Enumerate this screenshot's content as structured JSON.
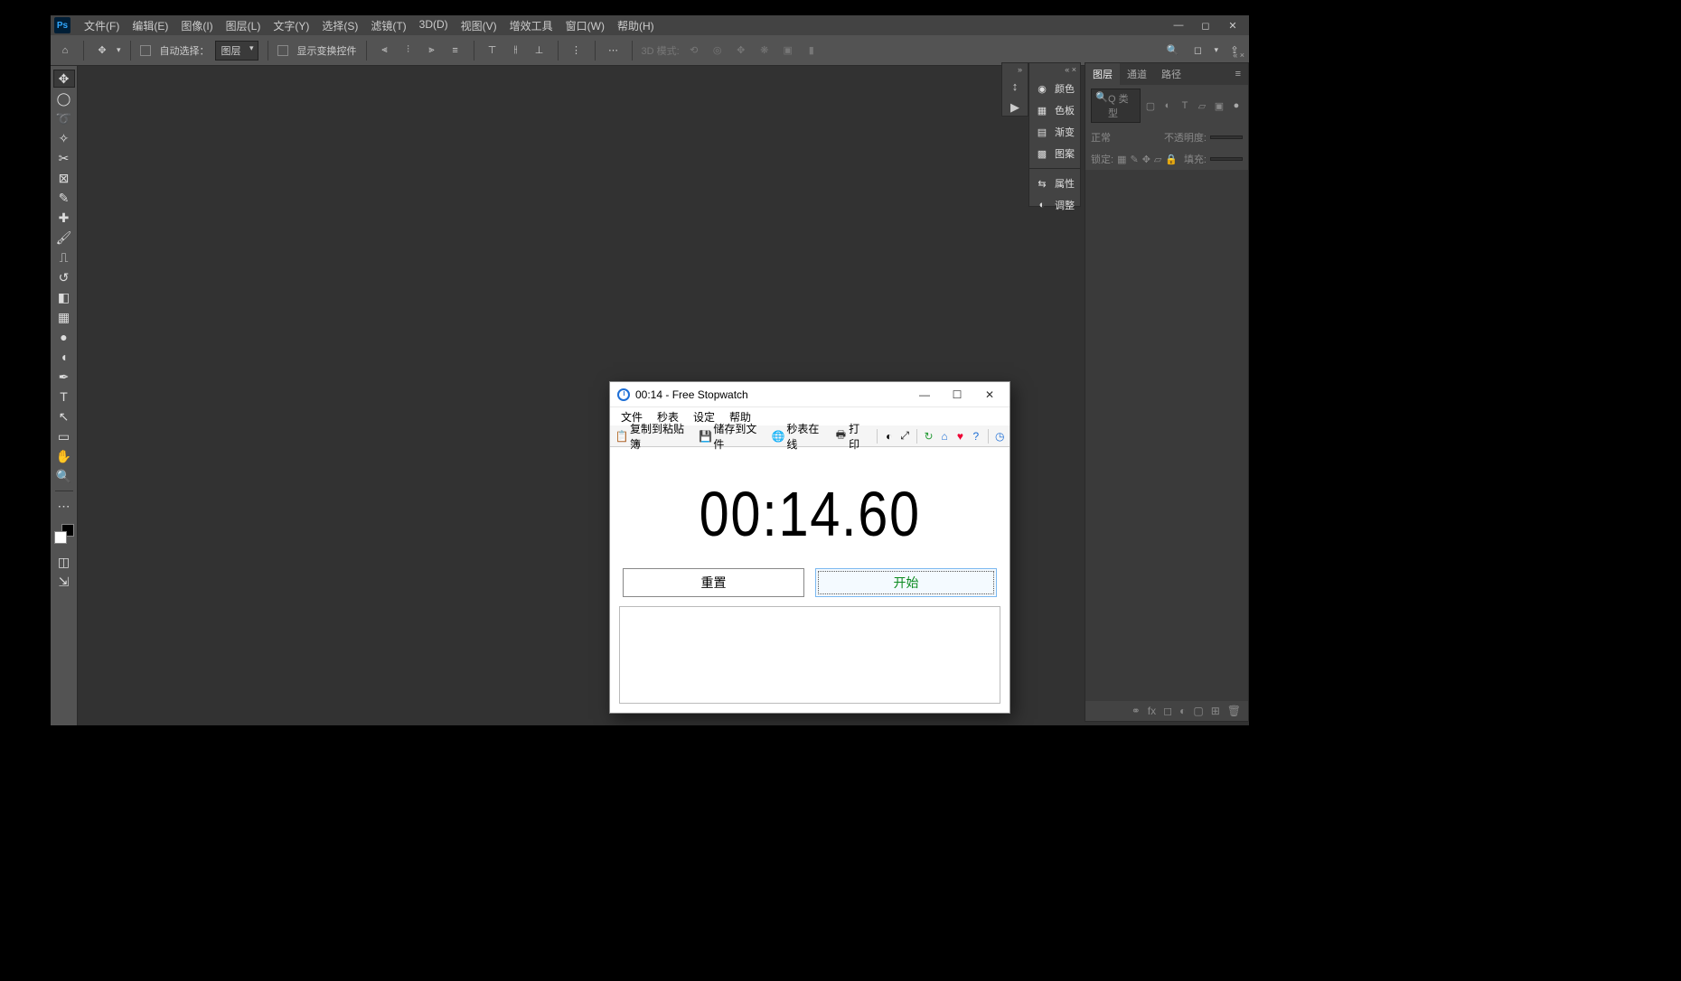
{
  "photoshop": {
    "menus": [
      "文件(F)",
      "编辑(E)",
      "图像(I)",
      "图层(L)",
      "文字(Y)",
      "选择(S)",
      "滤镜(T)",
      "3D(D)",
      "视图(V)",
      "增效工具",
      "窗口(W)",
      "帮助(H)"
    ],
    "options": {
      "auto_select_label": "自动选择：",
      "layer_dropdown": "图层",
      "show_transform_label": "显示变换控件",
      "mode3d_label": "3D 模式:"
    },
    "panels": {
      "rows": [
        {
          "icon": "◉",
          "label": "颜色"
        },
        {
          "icon": "▦",
          "label": "色板"
        },
        {
          "icon": "▤",
          "label": "渐变"
        },
        {
          "icon": "▩",
          "label": "图案"
        },
        {
          "sep": true
        },
        {
          "icon": "⇆",
          "label": "属性"
        },
        {
          "icon": "◐",
          "label": "调整"
        }
      ]
    },
    "layers": {
      "tabs": [
        "图层",
        "通道",
        "路径"
      ],
      "search_placeholder": "Q 类型",
      "blend": "正常",
      "opacity_label": "不透明度:",
      "lock_label": "锁定:",
      "fill_label": "填充:"
    }
  },
  "stopwatch": {
    "title": "00:14 - Free Stopwatch",
    "menus": [
      "文件",
      "秒表",
      "设定",
      "帮助"
    ],
    "toolbar": {
      "copy": "复制到粘贴簿",
      "save": "储存到文件",
      "online": "秒表在线",
      "print": "打印"
    },
    "time": "00:14.60",
    "reset_label": "重置",
    "start_label": "开始"
  }
}
